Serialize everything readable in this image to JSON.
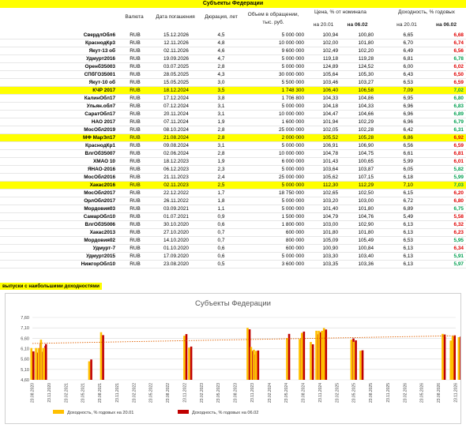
{
  "title": "Субъекты Федерации",
  "headers": {
    "valuta": "Валюта",
    "maturity": "Дата погашения",
    "duration": "Дюрация, лет",
    "volume": "Объем в обращении,",
    "volume2": "тыс. руб.",
    "price": "Цена, % от номинала",
    "yield": "Доходность, % годовых",
    "d1": "на 20.01",
    "d2": "на 06.02",
    "d3": "на 20.01",
    "d4": "на 06.02"
  },
  "rows": [
    {
      "name": "СвердлОбл6",
      "cur": "RUB",
      "date": "15.12.2026",
      "dur": "4,5",
      "vol": "5 000 000",
      "p1": "100,94",
      "p2": "100,80",
      "y1": "6,65",
      "y2": "6,68",
      "c": "red",
      "hl": false
    },
    {
      "name": "КраснодКр3",
      "cur": "RUB",
      "date": "12.11.2026",
      "dur": "4,8",
      "vol": "10 000 000",
      "p1": "102,00",
      "p2": "101,80",
      "y1": "6,70",
      "y2": "6,74",
      "c": "red",
      "hl": false
    },
    {
      "name": "Якут-13 об",
      "cur": "RUB",
      "date": "02.11.2026",
      "dur": "4,6",
      "vol": "9 600 000",
      "p1": "102,49",
      "p2": "102,20",
      "y1": "6,49",
      "y2": "6,56",
      "c": "red",
      "hl": false
    },
    {
      "name": "Удмурт2016",
      "cur": "RUB",
      "date": "19.09.2026",
      "dur": "4,7",
      "vol": "5 000 000",
      "p1": "119,18",
      "p2": "119,28",
      "y1": "6,81",
      "y2": "6,78",
      "c": "green",
      "hl": false
    },
    {
      "name": "ОренбЗ5003",
      "cur": "RUB",
      "date": "03.07.2025",
      "dur": "2,8",
      "vol": "5 000 000",
      "p1": "124,89",
      "p2": "124,52",
      "y1": "6,00",
      "y2": "6,02",
      "c": "red",
      "hl": false
    },
    {
      "name": "СПбГО35001",
      "cur": "RUB",
      "date": "28.05.2025",
      "dur": "4,3",
      "vol": "30 000 000",
      "p1": "105,64",
      "p2": "105,30",
      "y1": "6,43",
      "y2": "6,50",
      "c": "red",
      "hl": false
    },
    {
      "name": "Якут-10 об",
      "cur": "RUB",
      "date": "15.05.2025",
      "dur": "3,0",
      "vol": "5 500 000",
      "p1": "103,46",
      "p2": "103,27",
      "y1": "6,53",
      "y2": "6,59",
      "c": "red",
      "hl": false
    },
    {
      "name": "КЧР 2017",
      "cur": "RUB",
      "date": "18.12.2024",
      "dur": "3,5",
      "vol": "1 748 300",
      "p1": "106,40",
      "p2": "106,58",
      "y1": "7,09",
      "y2": "7,02",
      "c": "green",
      "hl": true
    },
    {
      "name": "КалинОбл17",
      "cur": "RUB",
      "date": "17.12.2024",
      "dur": "3,8",
      "vol": "1 706 800",
      "p1": "104,33",
      "p2": "104,86",
      "y1": "6,95",
      "y2": "6,80",
      "c": "green",
      "hl": false
    },
    {
      "name": "Ульян.обл7",
      "cur": "RUB",
      "date": "07.12.2024",
      "dur": "3,1",
      "vol": "5 000 000",
      "p1": "104,18",
      "p2": "104,33",
      "y1": "6,96",
      "y2": "6,83",
      "c": "green",
      "hl": false
    },
    {
      "name": "СаратОбл17",
      "cur": "RUB",
      "date": "20.11.2024",
      "dur": "3,1",
      "vol": "10 000 000",
      "p1": "104,47",
      "p2": "104,66",
      "y1": "6,96",
      "y2": "6,89",
      "c": "green",
      "hl": false
    },
    {
      "name": "НАО 2017",
      "cur": "RUB",
      "date": "07.11.2024",
      "dur": "1,9",
      "vol": "1 600 000",
      "p1": "101,94",
      "p2": "102,29",
      "y1": "6,96",
      "y2": "6,79",
      "c": "green",
      "hl": false
    },
    {
      "name": "МосОбл2019",
      "cur": "RUB",
      "date": "08.10.2024",
      "dur": "2,8",
      "vol": "25 000 000",
      "p1": "102,05",
      "p2": "102,28",
      "y1": "6,42",
      "y2": "6,31",
      "c": "green",
      "hl": false
    },
    {
      "name": "МФ МарЭл17",
      "cur": "RUB",
      "date": "21.08.2024",
      "dur": "2,8",
      "vol": "2 000 000",
      "p1": "105,52",
      "p2": "105,28",
      "y1": "6,86",
      "y2": "6,92",
      "c": "red",
      "hl": true
    },
    {
      "name": "КраснодКр1",
      "cur": "RUB",
      "date": "09.08.2024",
      "dur": "3,1",
      "vol": "5 000 000",
      "p1": "106,91",
      "p2": "106,90",
      "y1": "6,56",
      "y2": "6,59",
      "c": "red",
      "hl": false
    },
    {
      "name": "ВлгОбЗ5007",
      "cur": "RUB",
      "date": "02.06.2024",
      "dur": "2,8",
      "vol": "10 000 000",
      "p1": "104,78",
      "p2": "104,75",
      "y1": "6,61",
      "y2": "6,81",
      "c": "red",
      "hl": false
    },
    {
      "name": "ХМАО 10",
      "cur": "RUB",
      "date": "18.12.2023",
      "dur": "1,9",
      "vol": "6 000 000",
      "p1": "101,43",
      "p2": "100,65",
      "y1": "5,99",
      "y2": "6,01",
      "c": "red",
      "hl": false
    },
    {
      "name": "ЯНАО-2016",
      "cur": "RUB",
      "date": "06.12.2023",
      "dur": "2,3",
      "vol": "5 000 000",
      "p1": "103,64",
      "p2": "103,87",
      "y1": "6,05",
      "y2": "5,82",
      "c": "green",
      "hl": false
    },
    {
      "name": "МосОбл2016",
      "cur": "RUB",
      "date": "21.11.2023",
      "dur": "2,4",
      "vol": "25 000 000",
      "p1": "105,62",
      "p2": "107,15",
      "y1": "6,18",
      "y2": "5,99",
      "c": "green",
      "hl": false
    },
    {
      "name": "Хакас2016",
      "cur": "RUB",
      "date": "02.11.2023",
      "dur": "2,5",
      "vol": "5 000 000",
      "p1": "112,30",
      "p2": "112,29",
      "y1": "7,10",
      "y2": "7,03",
      "c": "green",
      "hl": true
    },
    {
      "name": "МосОбл2017",
      "cur": "RUB",
      "date": "22.12.2022",
      "dur": "1,7",
      "vol": "18 750 000",
      "p1": "102,65",
      "p2": "102,50",
      "y1": "6,15",
      "y2": "6,20",
      "c": "red",
      "hl": false
    },
    {
      "name": "ОрлОбл2017",
      "cur": "RUB",
      "date": "26.11.2022",
      "dur": "1,8",
      "vol": "5 000 000",
      "p1": "103,20",
      "p2": "103,00",
      "y1": "6,72",
      "y2": "6,80",
      "c": "red",
      "hl": false
    },
    {
      "name": "Мордовия03",
      "cur": "RUB",
      "date": "03.09.2021",
      "dur": "1,1",
      "vol": "5 000 000",
      "p1": "101,40",
      "p2": "101,80",
      "y1": "6,89",
      "y2": "6,75",
      "c": "green",
      "hl": false
    },
    {
      "name": "СамарОбл10",
      "cur": "RUB",
      "date": "01.07.2021",
      "dur": "0,9",
      "vol": "1 500 000",
      "p1": "104,79",
      "p2": "104,76",
      "y1": "5,49",
      "y2": "5,58",
      "c": "red",
      "hl": false
    },
    {
      "name": "ВлгОбЗ5006",
      "cur": "RUB",
      "date": "30.10.2020",
      "dur": "0,6",
      "vol": "1 800 000",
      "p1": "103,00",
      "p2": "102,90",
      "y1": "6,13",
      "y2": "6,32",
      "c": "red",
      "hl": false
    },
    {
      "name": "Хакас2013",
      "cur": "RUB",
      "date": "27.10.2020",
      "dur": "0,7",
      "vol": "600 000",
      "p1": "101,80",
      "p2": "101,80",
      "y1": "6,13",
      "y2": "6,23",
      "c": "red",
      "hl": false
    },
    {
      "name": "Мордовия02",
      "cur": "RUB",
      "date": "14.10.2020",
      "dur": "0,7",
      "vol": "800 000",
      "p1": "105,09",
      "p2": "105,49",
      "y1": "6,53",
      "y2": "5,95",
      "c": "green",
      "hl": false
    },
    {
      "name": "Удмурт-7",
      "cur": "RUB",
      "date": "01.10.2020",
      "dur": "0,6",
      "vol": "600 000",
      "p1": "100,90",
      "p2": "100,84",
      "y1": "6,13",
      "y2": "6,34",
      "c": "red",
      "hl": false
    },
    {
      "name": "Удмурт2015",
      "cur": "RUB",
      "date": "17.09.2020",
      "dur": "0,6",
      "vol": "5 000 000",
      "p1": "103,30",
      "p2": "103,40",
      "y1": "6,13",
      "y2": "5,91",
      "c": "green",
      "hl": false
    },
    {
      "name": "НижгорОбл10",
      "cur": "RUB",
      "date": "23.08.2020",
      "dur": "0,5",
      "vol": "3 600 000",
      "p1": "103,35",
      "p2": "103,36",
      "y1": "6,13",
      "y2": "5,97",
      "c": "green",
      "hl": false
    }
  ],
  "note": "выпуски с наибольшими доходностями",
  "chart_data": {
    "type": "bar",
    "title": "Субъекты Федерации",
    "ylim": [
      4.6,
      7.6
    ],
    "yticks": [
      "4,60",
      "5,10",
      "5,60",
      "6,10",
      "6,60",
      "7,10",
      "7,60"
    ],
    "xticks": [
      "23.08.2020",
      "23.11.2020",
      "23.02.2021",
      "23.05.2021",
      "23.08.2021",
      "23.11.2021",
      "23.02.2022",
      "23.05.2022",
      "23.08.2022",
      "23.11.2022",
      "23.02.2023",
      "23.05.2023",
      "23.08.2023",
      "23.11.2023",
      "23.02.2024",
      "23.05.2024",
      "23.08.2024",
      "23.11.2024",
      "23.02.2025",
      "23.05.2025",
      "23.08.2025",
      "23.11.2025",
      "23.02.2026",
      "23.05.2026",
      "23.08.2026",
      "23.11.2026"
    ],
    "x_dates": [
      "23.08.2020",
      "17.09.2020",
      "01.10.2020",
      "14.10.2020",
      "27.10.2020",
      "30.10.2020",
      "01.07.2021",
      "03.09.2021",
      "26.11.2022",
      "22.12.2022",
      "02.11.2023",
      "21.11.2023",
      "06.12.2023",
      "18.12.2023",
      "02.06.2024",
      "09.08.2024",
      "21.08.2024",
      "08.10.2024",
      "07.11.2024",
      "20.11.2024",
      "07.12.2024",
      "17.12.2024",
      "18.12.2024",
      "15.05.2025",
      "28.05.2025",
      "03.07.2025",
      "19.09.2026",
      "02.11.2026",
      "12.11.2026",
      "15.12.2026"
    ],
    "series": [
      {
        "name": "Доходность, % годовых на 20.01",
        "color": "#ffc000",
        "values": [
          6.13,
          6.13,
          6.13,
          6.53,
          6.13,
          6.13,
          5.49,
          6.89,
          6.72,
          6.15,
          7.1,
          6.18,
          6.05,
          5.99,
          6.61,
          6.56,
          6.86,
          6.42,
          6.96,
          6.96,
          6.96,
          6.95,
          7.09,
          6.53,
          6.43,
          6.0,
          6.81,
          6.49,
          6.7,
          6.65
        ]
      },
      {
        "name": "Доходность, % годовых на 06.02",
        "color": "#c00000",
        "values": [
          5.97,
          5.91,
          6.34,
          5.95,
          6.23,
          6.32,
          5.58,
          6.75,
          6.8,
          6.2,
          7.03,
          5.99,
          5.82,
          6.01,
          6.81,
          6.59,
          6.92,
          6.31,
          6.79,
          6.89,
          6.83,
          6.8,
          7.02,
          6.59,
          6.5,
          6.02,
          6.78,
          6.56,
          6.74,
          6.68
        ]
      }
    ],
    "trendline": {
      "color": "#e06000",
      "from": 6.35,
      "to": 6.72
    },
    "grid": true,
    "legend": "bottom"
  }
}
